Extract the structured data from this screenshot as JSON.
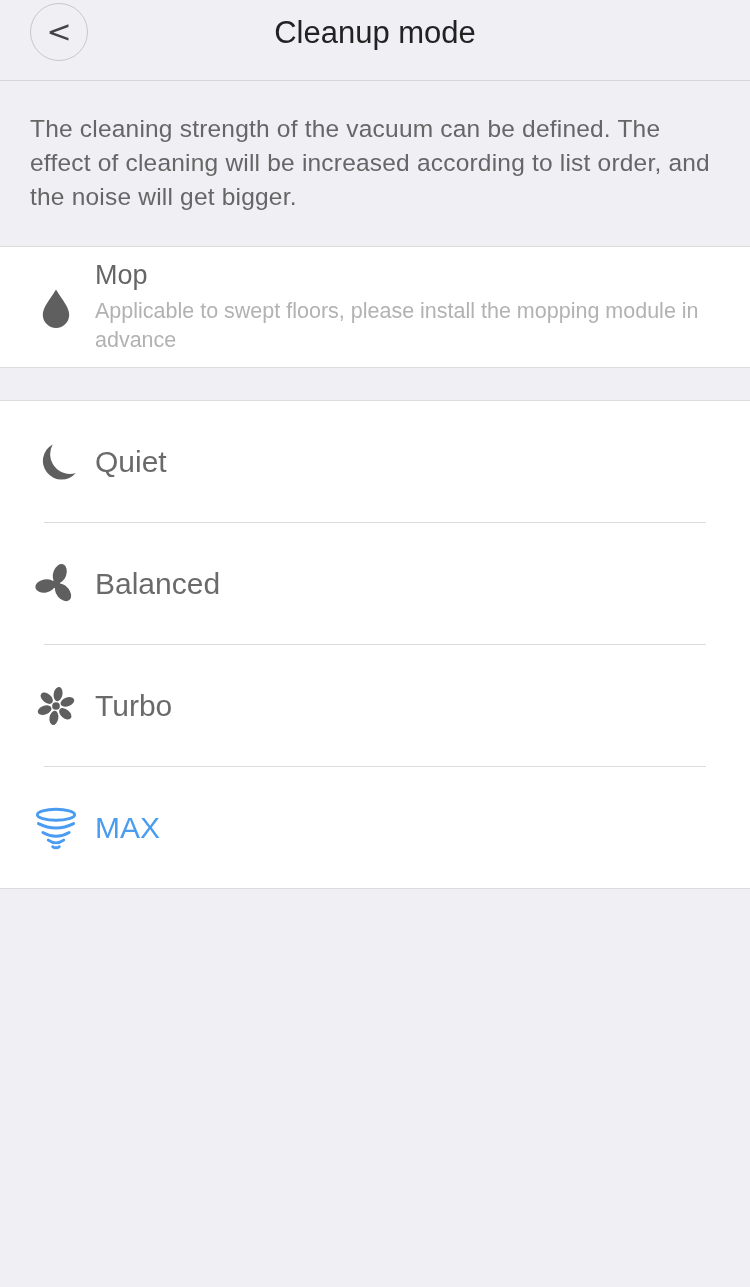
{
  "header": {
    "back_icon": "<",
    "title": "Cleanup mode"
  },
  "description": "The cleaning strength of the vacuum can be defined. The effect of cleaning will be increased according to list order, and the noise will get bigger.",
  "mop": {
    "kind": "drop",
    "title": "Mop",
    "subtitle": "Applicable to swept floors, please install the mopping module in advance",
    "selected": false
  },
  "modes": [
    {
      "kind": "moon",
      "label": "Quiet",
      "selected": false
    },
    {
      "kind": "fan3",
      "label": "Balanced",
      "selected": false
    },
    {
      "kind": "fan6",
      "label": "Turbo",
      "selected": false
    },
    {
      "kind": "tornado",
      "label": "MAX",
      "selected": true
    }
  ]
}
